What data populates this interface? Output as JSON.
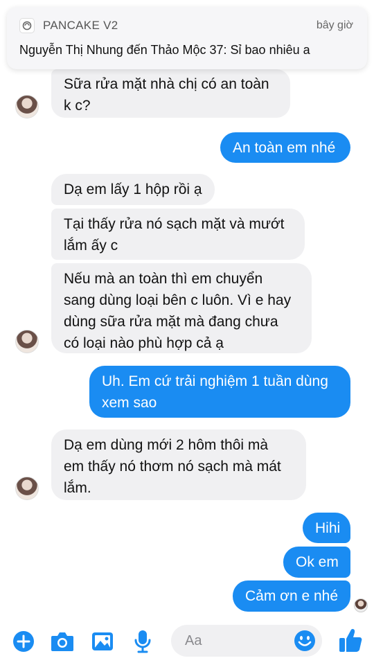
{
  "notification": {
    "app_name": "PANCAKE V2",
    "time": "bây giờ",
    "body": "Nguyễn Thị Nhung đến Thảo Mộc 37: Sỉ bao nhiêu a"
  },
  "messages": [
    {
      "side": "in",
      "text": "Sữa rửa mặt nhà chị có an toàn\nk c?"
    },
    {
      "side": "out",
      "text": "An toàn em nhé"
    },
    {
      "side": "in",
      "text": "Dạ em lấy 1 hộp rồi ạ"
    },
    {
      "side": "in",
      "text": "Tại thấy rửa nó sạch mặt và mướt\nlắm ấy c"
    },
    {
      "side": "in",
      "text": "Nếu mà an toàn thì em chuyển\nsang dùng loại bên c luôn. Vì e hay\ndùng sữa rửa mặt mà đang chưa\ncó loại nào phù hợp cả ạ"
    },
    {
      "side": "out",
      "text": "Uh. Em cứ trải nghiệm 1 tuần dùng\nxem sao"
    },
    {
      "side": "in",
      "text": "Dạ em dùng mới 2 hôm thôi mà\nem thấy nó thơm nó sạch mà mát\nlắm."
    },
    {
      "side": "out",
      "text": "Hihi"
    },
    {
      "side": "out",
      "text": "Ok em"
    },
    {
      "side": "out",
      "text": "Cảm ơn e nhé"
    }
  ],
  "composer": {
    "placeholder": "Aa",
    "icons": [
      "plus-icon",
      "camera-icon",
      "image-icon",
      "microphone-icon",
      "emoji-icon",
      "thumbs-up-icon"
    ]
  },
  "colors": {
    "outgoing_bubble": "#1a8cf2",
    "incoming_bubble": "#f0f0f2",
    "accent": "#1a8cf2"
  }
}
